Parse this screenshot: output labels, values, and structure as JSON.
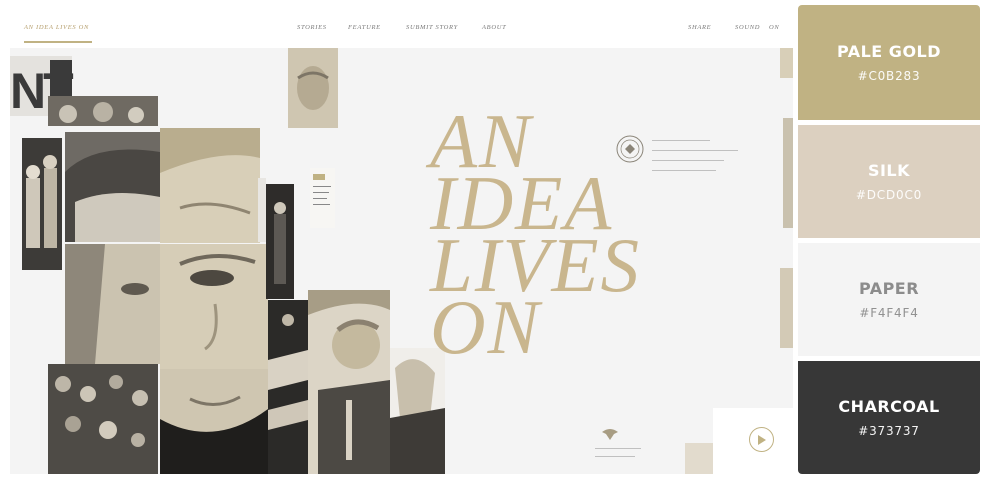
{
  "site": {
    "nav": {
      "brand": "AN IDEA LIVES ON",
      "links": [
        "STORIES",
        "FEATURE",
        "SUBMIT STORY",
        "ABOUT"
      ],
      "share": "SHARE",
      "sound_label": "SOUND",
      "sound_state": "ON"
    },
    "collage_text": "NT",
    "headline": [
      "AN",
      "IDEA",
      "LIVES",
      "ON"
    ],
    "accent_color": "#c0b283",
    "icons": [
      "presidential-seal-icon",
      "eagle-emblem-icon",
      "play-icon"
    ]
  },
  "palette": [
    {
      "name": "PALE GOLD",
      "hex": "#C0B283",
      "color": "#C0B283"
    },
    {
      "name": "SILK",
      "hex": "#DCD0C0",
      "color": "#DCD0C0"
    },
    {
      "name": "PAPER",
      "hex": "#F4F4F4",
      "color": "#F4F4F4"
    },
    {
      "name": "CHARCOAL",
      "hex": "#373737",
      "color": "#373737"
    }
  ]
}
